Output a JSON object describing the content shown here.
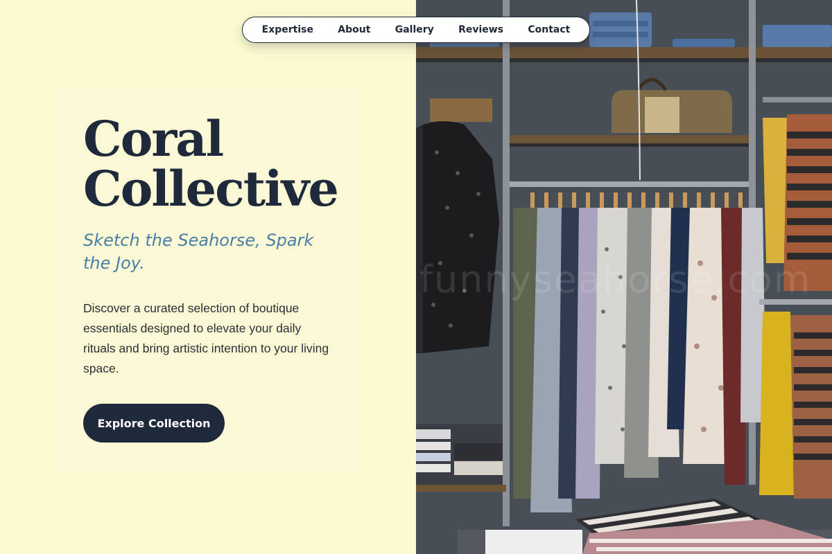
{
  "nav": {
    "items": [
      {
        "label": "Expertise"
      },
      {
        "label": "About"
      },
      {
        "label": "Gallery"
      },
      {
        "label": "Reviews"
      },
      {
        "label": "Contact"
      }
    ]
  },
  "hero": {
    "title_line1": "Coral",
    "title_line2": "Collective",
    "tagline": "Sketch the Seahorse, Spark the Joy.",
    "description": "Discover a curated selection of boutique essentials designed to elevate your daily rituals and bring artistic intention to your living space.",
    "cta_label": "Explore Collection"
  },
  "photo": {
    "watermark": "funnyseahorse.com"
  },
  "colors": {
    "background": "#fbf9d0",
    "primary": "#1e293b",
    "accent": "#4a7fa8"
  }
}
